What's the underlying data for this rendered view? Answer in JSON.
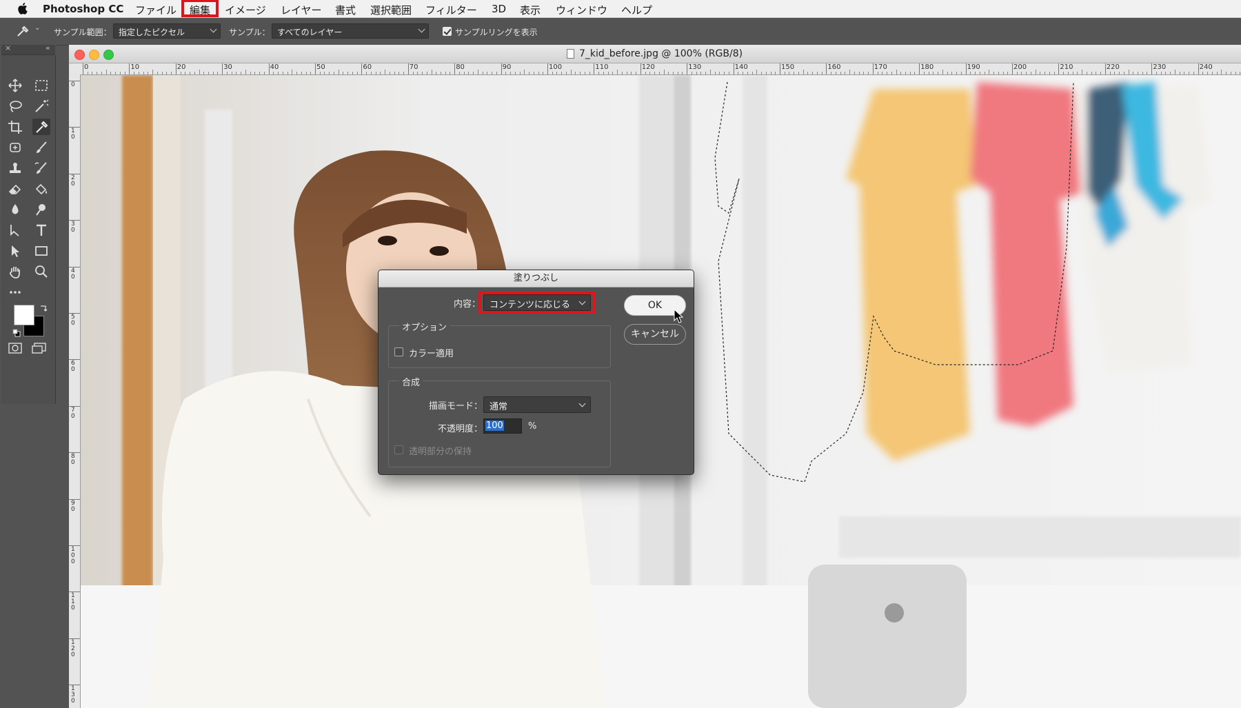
{
  "menubar": {
    "app_name": "Photoshop CC",
    "items": [
      "ファイル",
      "編集",
      "イメージ",
      "レイヤー",
      "書式",
      "選択範囲",
      "フィルター",
      "3D",
      "表示",
      "ウィンドウ",
      "ヘルプ"
    ],
    "highlighted_item": "編集"
  },
  "options_bar": {
    "sample_size_label": "サンプル範囲：",
    "sample_size_value": "指定したピクセル",
    "sample_label": "サンプル：",
    "sample_value": "すべてのレイヤー",
    "show_ring_label": "サンプルリングを表示",
    "show_ring_checked": true
  },
  "document": {
    "title": "7_kid_before.jpg @ 100% (RGB/8)",
    "h_ruler_ticks": [
      "0",
      "10",
      "20",
      "30",
      "40",
      "50",
      "60",
      "70",
      "80",
      "90",
      "100",
      "110",
      "120",
      "130",
      "140",
      "150",
      "160",
      "170",
      "180",
      "190",
      "200",
      "210",
      "220",
      "230",
      "240"
    ],
    "v_ruler_ticks": [
      "0",
      "10",
      "20",
      "30",
      "40",
      "50",
      "60",
      "70",
      "80",
      "90",
      "100",
      "110",
      "120",
      "130"
    ]
  },
  "fill_dialog": {
    "title": "塗りつぶし",
    "content_label": "内容：",
    "content_value": "コンテンツに応じる",
    "ok_label": "OK",
    "cancel_label": "キャンセル",
    "options_group": "オプション",
    "color_adapt_label": "カラー適用",
    "color_adapt_checked": false,
    "blending_group": "合成",
    "mode_label": "描画モード：",
    "mode_value": "通常",
    "opacity_label": "不透明度：",
    "opacity_value": "100",
    "opacity_unit": "%",
    "preserve_transparency_label": "透明部分の保持",
    "preserve_transparency_enabled": false
  },
  "colors": {
    "highlight_red": "#e0141a",
    "panel_bg": "#535353",
    "selection_blue": "#2f6fc8"
  }
}
